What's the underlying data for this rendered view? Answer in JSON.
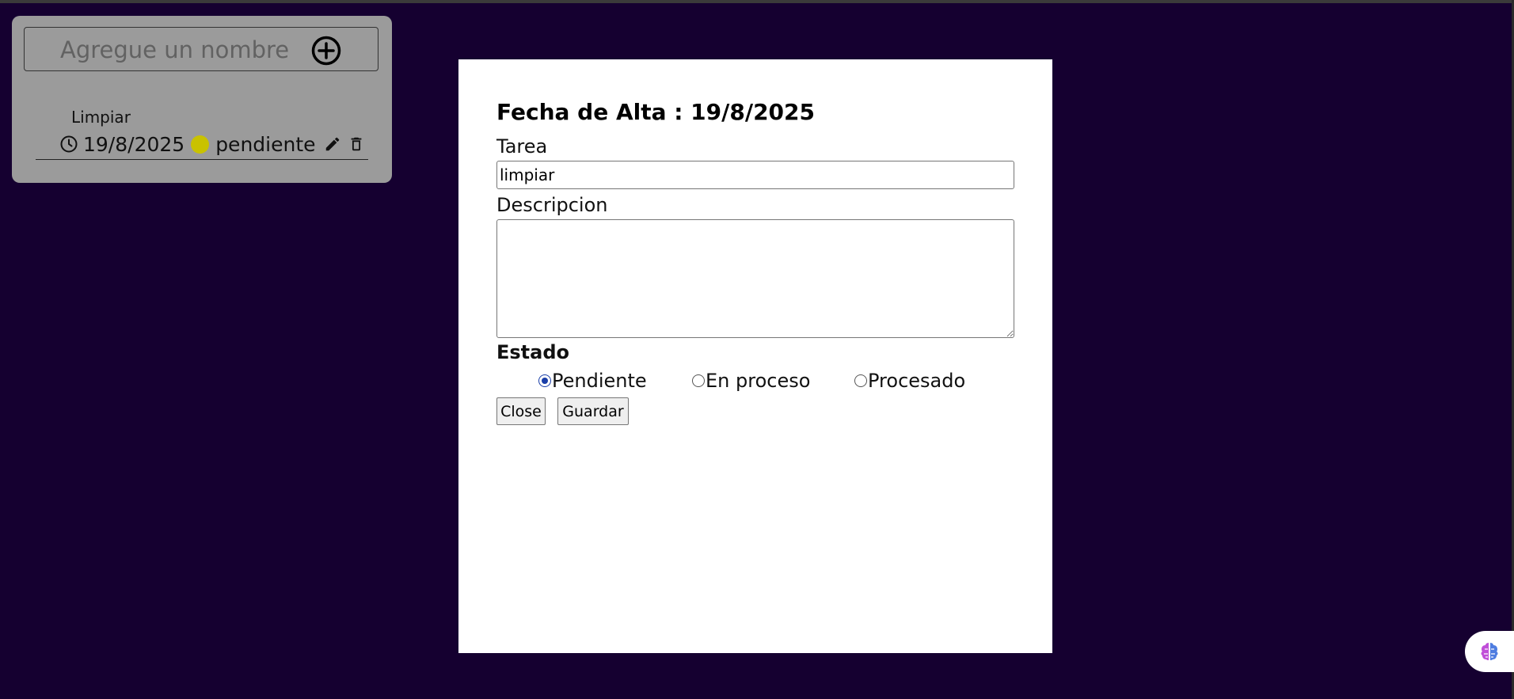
{
  "todo_panel": {
    "name_input_placeholder": "Agregue un nombre",
    "tasks": [
      {
        "title": "Limpiar",
        "date": "19/8/2025",
        "status": "pendiente",
        "status_color": "#c9c200"
      }
    ]
  },
  "modal": {
    "title": "Fecha de Alta : 19/8/2025",
    "tarea_label": "Tarea",
    "tarea_value": "limpiar",
    "descripcion_label": "Descripcion",
    "descripcion_value": "",
    "estado_label": "Estado",
    "estado_options": [
      {
        "label": "Pendiente",
        "checked": true
      },
      {
        "label": "En proceso",
        "checked": false
      },
      {
        "label": "Procesado",
        "checked": false
      }
    ],
    "close_label": "Close",
    "save_label": "Guardar"
  },
  "icons": {
    "add": "plus-circle-icon",
    "clock": "clock-icon",
    "edit": "pencil-icon",
    "delete": "trash-icon",
    "assistant": "brain-icon"
  },
  "colors": {
    "background": "#150030",
    "panel": "#9b9b9b",
    "radio_selected": "#1a3ea8"
  }
}
